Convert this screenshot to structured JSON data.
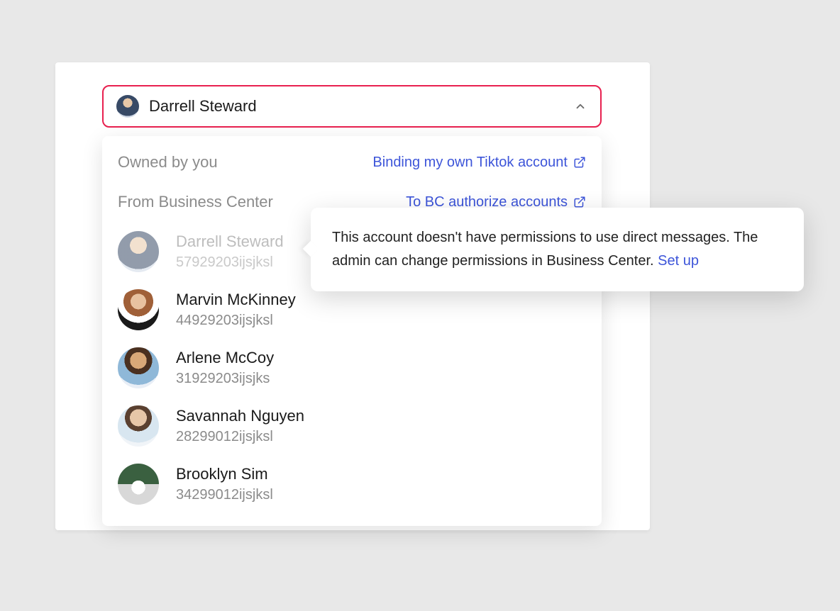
{
  "select": {
    "selected_name": "Darrell Steward"
  },
  "dropdown": {
    "owned_label": "Owned by you",
    "owned_link": "Binding my own Tiktok account",
    "bc_label": "From Business Center",
    "bc_link": "To BC authorize accounts",
    "accounts": [
      {
        "name": "Darrell Steward",
        "id": "57929203ijsjksl",
        "disabled": true
      },
      {
        "name": "Marvin McKinney",
        "id": "44929203ijsjksl",
        "disabled": false
      },
      {
        "name": "Arlene McCoy",
        "id": "31929203ijsjks",
        "disabled": false
      },
      {
        "name": "Savannah Nguyen",
        "id": "28299012ijsjksl",
        "disabled": false
      },
      {
        "name": "Brooklyn Sim",
        "id": "34299012ijsjksl",
        "disabled": false
      }
    ]
  },
  "tooltip": {
    "text": "This account doesn't have permissions to use direct messages. The admin can change permissions in Business Center. ",
    "link": "Set up"
  },
  "colors": {
    "accent": "#e8204f",
    "link": "#3d55d9"
  }
}
